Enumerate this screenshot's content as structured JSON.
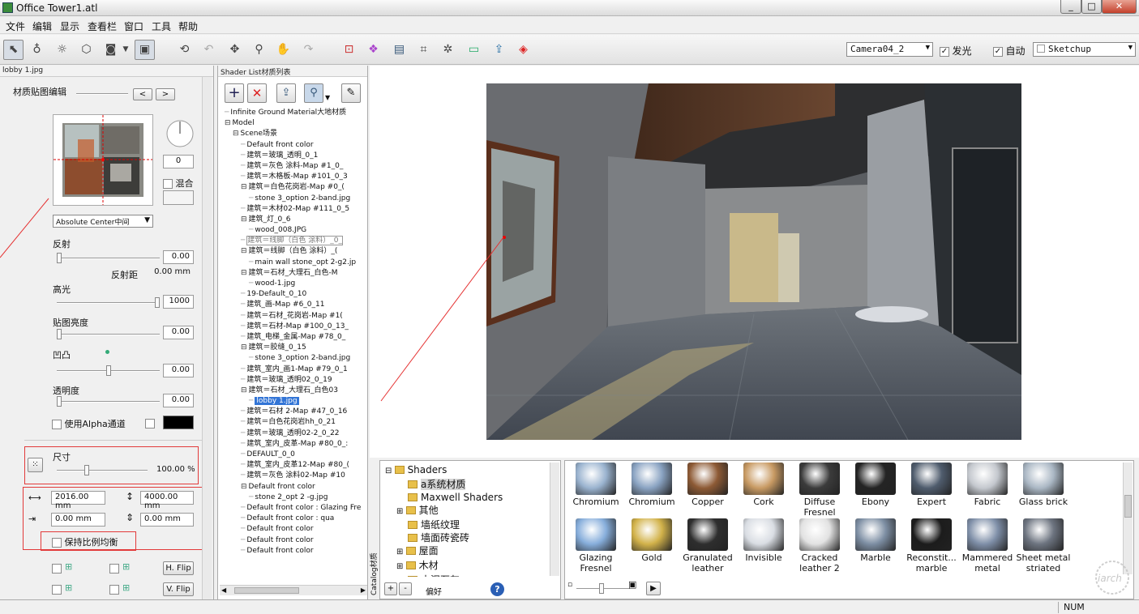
{
  "window": {
    "title": "Office Tower1.atl",
    "controls": [
      "_",
      "□",
      "✕"
    ]
  },
  "menu": [
    "文件",
    "编辑",
    "显示",
    "查看栏",
    "窗口",
    "工具",
    "帮助"
  ],
  "toolbar": {
    "camera": "Camera04_2",
    "glow_label": "发光",
    "glow_checked": true,
    "auto_label": "自动",
    "auto_checked": true,
    "preset": "Sketchup"
  },
  "left_panel": {
    "header": "lobby 1.jpg",
    "title": "材质贴图编辑",
    "nav_prev": "<",
    "nav_next": ">",
    "angle_value": "0",
    "blend_label": "混合",
    "mapping": "Absolute Center中间",
    "reflection_label": "反射",
    "reflection_value": "0.00",
    "reflection_distance_label": "反射距",
    "reflection_distance_value": "0.00 mm",
    "highlight_label": "高光",
    "highlight_value": "1000",
    "map_brightness_label": "贴图亮度",
    "map_brightness_value": "0.00",
    "bump_label": "凹凸",
    "bump_value": "0.00",
    "transparency_label": "透明度",
    "transparency_value": "0.00",
    "alpha_label": "使用Alpha通道",
    "size_label": "尺寸",
    "size_value": "100.00 %",
    "width_value": "2016.00 mm",
    "height_value": "4000.00 mm",
    "offset_x_value": "0.00 mm",
    "offset_y_value": "0.00 mm",
    "keep_ratio_label": "保持比例均衡",
    "hflip_label": "H. Flip",
    "vflip_label": "V. Flip",
    "slider_levels": {
      "reflection": 0.0,
      "highlight": 1.0,
      "map_brightness": 0.0,
      "bump": 0.5,
      "transparency": 0.0,
      "size": 0.32
    }
  },
  "shader_panel": {
    "header": "Shader List材质列表",
    "tree": [
      {
        "d": 0,
        "t": "Infinite Ground Material大地材质"
      },
      {
        "d": 0,
        "t": "Model",
        "x": "⊟"
      },
      {
        "d": 1,
        "t": "Scene场景",
        "x": "⊟"
      },
      {
        "d": 2,
        "t": "Default front color"
      },
      {
        "d": 2,
        "t": "建筑＝玻璃_透明_0_1"
      },
      {
        "d": 2,
        "t": "建筑＝灰色 涂料-Map #1_0_"
      },
      {
        "d": 2,
        "t": "建筑＝木格板-Map #101_0_3"
      },
      {
        "d": 2,
        "t": "建筑＝白色花岗岩-Map #0_(",
        "x": "⊟"
      },
      {
        "d": 3,
        "t": "stone 3_option 2-band.jpg"
      },
      {
        "d": 2,
        "t": "建筑＝木材02-Map #111_0_5"
      },
      {
        "d": 2,
        "t": "建筑_灯_0_6",
        "x": "⊟"
      },
      {
        "d": 3,
        "t": "wood_008.JPG"
      },
      {
        "d": 2,
        "t": "建筑＝线脚（白色 涂料）_0_",
        "hl": "box"
      },
      {
        "d": 2,
        "t": "建筑＝线脚（白色 涂料）_(",
        "x": "⊟"
      },
      {
        "d": 3,
        "t": "main wall stone_opt 2-g2.jp"
      },
      {
        "d": 2,
        "t": "建筑＝石材_大理石_白色-M",
        "x": "⊟"
      },
      {
        "d": 3,
        "t": "wood-1.jpg"
      },
      {
        "d": 2,
        "t": "19-Default_0_10"
      },
      {
        "d": 2,
        "t": "建筑_画-Map #6_0_11"
      },
      {
        "d": 2,
        "t": "建筑＝石材_花岗岩-Map #1("
      },
      {
        "d": 2,
        "t": "建筑＝石材-Map #100_0_13_"
      },
      {
        "d": 2,
        "t": "建筑_电梯_金属-Map #78_0_"
      },
      {
        "d": 2,
        "t": "建筑＝胶缝_0_15",
        "x": "⊟"
      },
      {
        "d": 3,
        "t": "stone 3_option 2-band.jpg"
      },
      {
        "d": 2,
        "t": "建筑_室内_画1-Map #79_0_1"
      },
      {
        "d": 2,
        "t": "建筑＝玻璃_透明02_0_19"
      },
      {
        "d": 2,
        "t": "建筑＝石材_大理石_白色03",
        "x": "⊟"
      },
      {
        "d": 3,
        "t": "lobby 1.jpg",
        "hl": "sel"
      },
      {
        "d": 2,
        "t": "建筑＝石材 2-Map #47_0_16"
      },
      {
        "d": 2,
        "t": "建筑＝白色花岗岩hh_0_21"
      },
      {
        "d": 2,
        "t": "建筑＝玻璃_透明02-2_0_22"
      },
      {
        "d": 2,
        "t": "建筑_室内_皮革-Map #80_0_:"
      },
      {
        "d": 2,
        "t": "DEFAULT_0_0"
      },
      {
        "d": 2,
        "t": "建筑_室内_皮革12-Map #80_("
      },
      {
        "d": 2,
        "t": "建筑＝灰色 涂料02-Map #10"
      },
      {
        "d": 2,
        "t": "Default front color",
        "x": "⊟"
      },
      {
        "d": 3,
        "t": "stone 2_opt 2 -g.jpg"
      },
      {
        "d": 2,
        "t": "Default front color : Glazing Fre"
      },
      {
        "d": 2,
        "t": "Default front color : qua"
      },
      {
        "d": 2,
        "t": "Default front color"
      },
      {
        "d": 2,
        "t": "Default front color"
      },
      {
        "d": 2,
        "t": "Default front color"
      }
    ]
  },
  "catalog": {
    "side_label": "Catalog材质",
    "folders": [
      {
        "d": 0,
        "t": "Shaders",
        "x": "⊟"
      },
      {
        "d": 1,
        "t": "a系统材质",
        "sel": true
      },
      {
        "d": 1,
        "t": "Maxwell Shaders"
      },
      {
        "d": 1,
        "t": "其他",
        "x": "⊞"
      },
      {
        "d": 1,
        "t": "墙纸纹理"
      },
      {
        "d": 1,
        "t": "墙面砖瓷砖"
      },
      {
        "d": 1,
        "t": "屋面",
        "x": "⊞"
      },
      {
        "d": 1,
        "t": "木材",
        "x": "⊞"
      },
      {
        "d": 1,
        "t": "水泥石灰"
      }
    ],
    "bottom_add": "+",
    "bottom_remove": "-",
    "favorites": "偏好",
    "help": "?",
    "materials_row1": [
      {
        "name": "Chromium",
        "color": "#9ab3cf"
      },
      {
        "name": "Chromium",
        "color": "#8aa3c2"
      },
      {
        "name": "Copper",
        "color": "#8d5a35"
      },
      {
        "name": "Cork",
        "color": "#c89a63"
      },
      {
        "name": "Diffuse Fresnel",
        "color": "#3b3b3b"
      },
      {
        "name": "Ebony",
        "color": "#242424"
      },
      {
        "name": "Expert",
        "color": "#4f5c6d"
      },
      {
        "name": "Fabric",
        "color": "#c4c8ce"
      },
      {
        "name": "Glass brick",
        "color": "#aab7c4"
      }
    ],
    "materials_row2": [
      {
        "name": "Glazing Fresnel",
        "color": "#87aedb"
      },
      {
        "name": "Gold",
        "color": "#d2b24a"
      },
      {
        "name": "Granulated leather",
        "color": "#2e2e2e"
      },
      {
        "name": "Invisible",
        "color": "#d9dde3"
      },
      {
        "name": "Cracked leather 2",
        "color": "#e2e2e2"
      },
      {
        "name": "Marble",
        "color": "#7d8ea3"
      },
      {
        "name": "Reconstit... marble",
        "color": "#1c1c1c"
      },
      {
        "name": "Mammered metal",
        "color": "#7f8fa8"
      },
      {
        "name": "Sheet metal striated",
        "color": "#6d7480"
      }
    ]
  },
  "status": {
    "num": "NUM"
  }
}
